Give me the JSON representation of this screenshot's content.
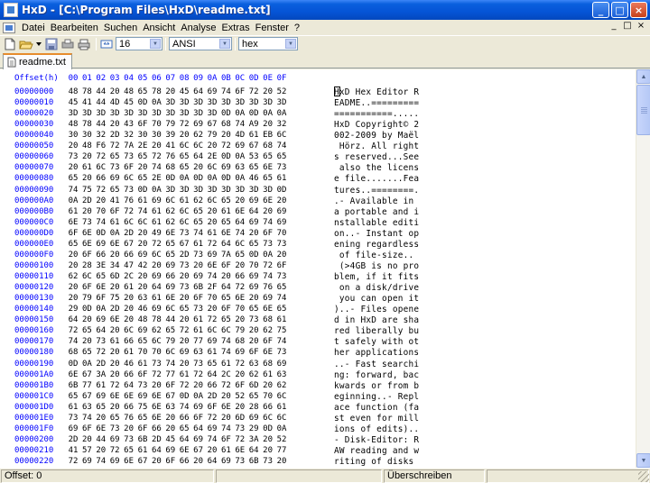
{
  "window": {
    "title": "HxD - [C:\\Program Files\\HxD\\readme.txt]",
    "controls": [
      "_",
      "□",
      "×"
    ]
  },
  "menu": {
    "items": [
      "Datei",
      "Bearbeiten",
      "Suchen",
      "Ansicht",
      "Analyse",
      "Extras",
      "Fenster",
      "?"
    ],
    "mdi_controls": [
      "_",
      "□",
      "×"
    ]
  },
  "toolbar": {
    "bytes_per_row": "16",
    "charset": "ANSI",
    "display_mode": "hex",
    "icons": [
      "new-file-icon",
      "open-file-icon",
      "save-icon",
      "tools-icon",
      "print-icon",
      "columns-icon"
    ]
  },
  "tabs": [
    {
      "label": "readme.txt",
      "active": true
    }
  ],
  "editor": {
    "offset_header": "Offset(h)",
    "column_headers": [
      "00",
      "01",
      "02",
      "03",
      "04",
      "05",
      "06",
      "07",
      "08",
      "09",
      "0A",
      "0B",
      "0C",
      "0D",
      "0E",
      "0F"
    ],
    "rows": [
      {
        "offset": "00000000",
        "hex": "48 78 44 20 48 65 78 20 45 64 69 74 6F 72 20 52",
        "ascii": "HxD Hex Editor R"
      },
      {
        "offset": "00000010",
        "hex": "45 41 44 4D 45 0D 0A 3D 3D 3D 3D 3D 3D 3D 3D 3D",
        "ascii": "EADME..========="
      },
      {
        "offset": "00000020",
        "hex": "3D 3D 3D 3D 3D 3D 3D 3D 3D 3D 3D 0D 0A 0D 0A 0A",
        "ascii": "===========....."
      },
      {
        "offset": "00000030",
        "hex": "48 78 44 20 43 6F 70 79 72 69 67 68 74 A9 20 32",
        "ascii": "HxD Copyright© 2"
      },
      {
        "offset": "00000040",
        "hex": "30 30 32 2D 32 30 30 39 20 62 79 20 4D 61 EB 6C",
        "ascii": "002-2009 by Maël"
      },
      {
        "offset": "00000050",
        "hex": "20 48 F6 72 7A 2E 20 41 6C 6C 20 72 69 67 68 74",
        "ascii": " Hörz. All right"
      },
      {
        "offset": "00000060",
        "hex": "73 20 72 65 73 65 72 76 65 64 2E 0D 0A 53 65 65",
        "ascii": "s reserved...See"
      },
      {
        "offset": "00000070",
        "hex": "20 61 6C 73 6F 20 74 68 65 20 6C 69 63 65 6E 73",
        "ascii": " also the licens"
      },
      {
        "offset": "00000080",
        "hex": "65 20 66 69 6C 65 2E 0D 0A 0D 0A 0D 0A 46 65 61",
        "ascii": "e file.......Fea"
      },
      {
        "offset": "00000090",
        "hex": "74 75 72 65 73 0D 0A 3D 3D 3D 3D 3D 3D 3D 3D 0D",
        "ascii": "tures..========."
      },
      {
        "offset": "000000A0",
        "hex": "0A 2D 20 41 76 61 69 6C 61 62 6C 65 20 69 6E 20",
        "ascii": ".- Available in "
      },
      {
        "offset": "000000B0",
        "hex": "61 20 70 6F 72 74 61 62 6C 65 20 61 6E 64 20 69",
        "ascii": "a portable and i"
      },
      {
        "offset": "000000C0",
        "hex": "6E 73 74 61 6C 6C 61 62 6C 65 20 65 64 69 74 69",
        "ascii": "nstallable editi"
      },
      {
        "offset": "000000D0",
        "hex": "6F 6E 0D 0A 2D 20 49 6E 73 74 61 6E 74 20 6F 70",
        "ascii": "on..- Instant op"
      },
      {
        "offset": "000000E0",
        "hex": "65 6E 69 6E 67 20 72 65 67 61 72 64 6C 65 73 73",
        "ascii": "ening regardless"
      },
      {
        "offset": "000000F0",
        "hex": "20 6F 66 20 66 69 6C 65 2D 73 69 7A 65 0D 0A 20",
        "ascii": " of file-size.. "
      },
      {
        "offset": "00000100",
        "hex": "20 28 3E 34 47 42 20 69 73 20 6E 6F 20 70 72 6F",
        "ascii": " (>4GB is no pro"
      },
      {
        "offset": "00000110",
        "hex": "62 6C 65 6D 2C 20 69 66 20 69 74 20 66 69 74 73",
        "ascii": "blem, if it fits"
      },
      {
        "offset": "00000120",
        "hex": "20 6F 6E 20 61 20 64 69 73 6B 2F 64 72 69 76 65",
        "ascii": " on a disk/drive"
      },
      {
        "offset": "00000130",
        "hex": "20 79 6F 75 20 63 61 6E 20 6F 70 65 6E 20 69 74",
        "ascii": " you can open it"
      },
      {
        "offset": "00000140",
        "hex": "29 0D 0A 2D 20 46 69 6C 65 73 20 6F 70 65 6E 65",
        "ascii": ")..- Files opene"
      },
      {
        "offset": "00000150",
        "hex": "64 20 69 6E 20 48 78 44 20 61 72 65 20 73 68 61",
        "ascii": "d in HxD are sha"
      },
      {
        "offset": "00000160",
        "hex": "72 65 64 20 6C 69 62 65 72 61 6C 6C 79 20 62 75",
        "ascii": "red liberally bu"
      },
      {
        "offset": "00000170",
        "hex": "74 20 73 61 66 65 6C 79 20 77 69 74 68 20 6F 74",
        "ascii": "t safely with ot"
      },
      {
        "offset": "00000180",
        "hex": "68 65 72 20 61 70 70 6C 69 63 61 74 69 6F 6E 73",
        "ascii": "her applications"
      },
      {
        "offset": "00000190",
        "hex": "0D 0A 2D 20 46 61 73 74 20 73 65 61 72 63 68 69",
        "ascii": "..- Fast searchi"
      },
      {
        "offset": "000001A0",
        "hex": "6E 67 3A 20 66 6F 72 77 61 72 64 2C 20 62 61 63",
        "ascii": "ng: forward, bac"
      },
      {
        "offset": "000001B0",
        "hex": "6B 77 61 72 64 73 20 6F 72 20 66 72 6F 6D 20 62",
        "ascii": "kwards or from b"
      },
      {
        "offset": "000001C0",
        "hex": "65 67 69 6E 6E 69 6E 67 0D 0A 2D 20 52 65 70 6C",
        "ascii": "eginning..- Repl"
      },
      {
        "offset": "000001D0",
        "hex": "61 63 65 20 66 75 6E 63 74 69 6F 6E 20 28 66 61",
        "ascii": "ace function (fa"
      },
      {
        "offset": "000001E0",
        "hex": "73 74 20 65 76 65 6E 20 66 6F 72 20 6D 69 6C 6C",
        "ascii": "st even for mill"
      },
      {
        "offset": "000001F0",
        "hex": "69 6F 6E 73 20 6F 66 20 65 64 69 74 73 29 0D 0A",
        "ascii": "ions of edits).."
      },
      {
        "offset": "00000200",
        "hex": "2D 20 44 69 73 6B 2D 45 64 69 74 6F 72 3A 20 52",
        "ascii": "- Disk-Editor: R"
      },
      {
        "offset": "00000210",
        "hex": "41 57 20 72 65 61 64 69 6E 67 20 61 6E 64 20 77",
        "ascii": "AW reading and w"
      },
      {
        "offset": "00000220",
        "hex": "72 69 74 69 6E 67 20 6F 66 20 64 69 73 6B 73 20",
        "ascii": "riting of disks "
      }
    ]
  },
  "status": {
    "offset": "Offset: 0",
    "mode": "Überschreiben"
  }
}
